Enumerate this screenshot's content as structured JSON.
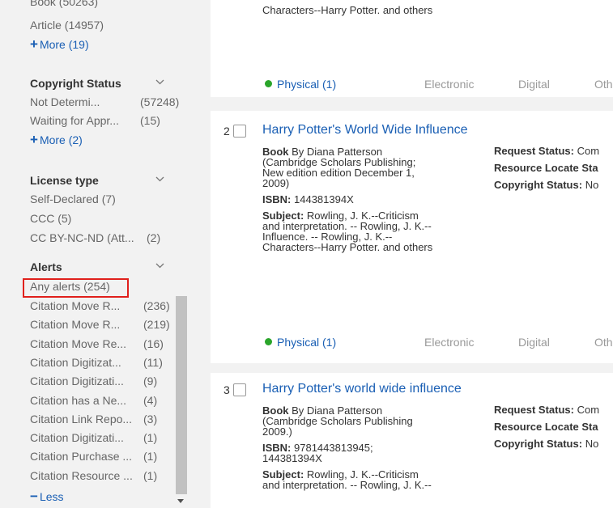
{
  "sidebar": {
    "top_rows": [
      {
        "label": "Book (50263)"
      },
      {
        "label": "Article (14957)"
      }
    ],
    "more_resource": "More (19)",
    "copyright": {
      "title": "Copyright Status",
      "rows": [
        {
          "label": "Not Determi...",
          "count": "(57248)"
        },
        {
          "label": "Waiting for Appr...",
          "count": "(15)"
        }
      ],
      "more": "More (2)"
    },
    "license": {
      "title": "License type",
      "rows": [
        {
          "label": "Self-Declared (7)"
        },
        {
          "label": "CCC (5)"
        },
        {
          "label": "CC BY-NC-ND (Att...",
          "count": "(2)"
        }
      ]
    },
    "alerts": {
      "title": "Alerts",
      "any": "Any alerts (254)",
      "rows": [
        {
          "label": "Citation Move R...",
          "count": "(236)"
        },
        {
          "label": "Citation Move R...",
          "count": "(219)"
        },
        {
          "label": "Citation Move Re...",
          "count": "(16)"
        },
        {
          "label": "Citation Digitizat...",
          "count": "(11)"
        },
        {
          "label": "Citation Digitizati...",
          "count": "(9)"
        },
        {
          "label": "Citation has a Ne...",
          "count": "(4)"
        },
        {
          "label": "Citation Link Repo...",
          "count": "(3)"
        },
        {
          "label": "Citation Digitizati...",
          "count": "(1)"
        },
        {
          "label": "Citation Purchase ...",
          "count": "(1)"
        },
        {
          "label": "Citation Resource ...",
          "count": "(1)"
        }
      ],
      "less": "Less"
    }
  },
  "results": {
    "tabs": {
      "physical": "Physical (1)",
      "electronic": "Electronic",
      "digital": "Digital",
      "other": "Oth"
    },
    "top_partial": "Characters--Harry Potter. and others",
    "items": [
      {
        "num": "2",
        "title": "Harry Potter's World Wide Influence",
        "lines": [
          "By Diana Patterson",
          "(Cambridge Scholars Publishing;",
          "New edition edition December 1,",
          "2009)"
        ],
        "type": "Book",
        "isbn_label": "ISBN:",
        "isbn": "144381394X",
        "subject_label": "Subject:",
        "subject_lines": [
          "Rowling, J. K.--Criticism",
          "and interpretation. -- Rowling, J. K.--",
          "Influence. -- Rowling, J. K.--",
          "Characters--Harry Potter. and others"
        ],
        "status": [
          {
            "label": "Request Status:",
            "value": "Com"
          },
          {
            "label": "Resource Locate Sta",
            "value": ""
          },
          {
            "label": "Copyright Status:",
            "value": "No"
          }
        ]
      },
      {
        "num": "3",
        "title": "Harry Potter's world wide influence",
        "lines": [
          "By Diana Patterson",
          "(Cambridge Scholars Publishing",
          "2009.)"
        ],
        "type": "Book",
        "isbn_label": "ISBN:",
        "isbn": "9781443813945;",
        "isbn2": "144381394X",
        "subject_label": "Subject:",
        "subject_lines": [
          "Rowling, J. K.--Criticism",
          "and interpretation. -- Rowling, J. K.--"
        ],
        "status": [
          {
            "label": "Request Status:",
            "value": "Com"
          },
          {
            "label": "Resource Locate Sta",
            "value": ""
          },
          {
            "label": "Copyright Status:",
            "value": "No"
          }
        ]
      }
    ]
  }
}
